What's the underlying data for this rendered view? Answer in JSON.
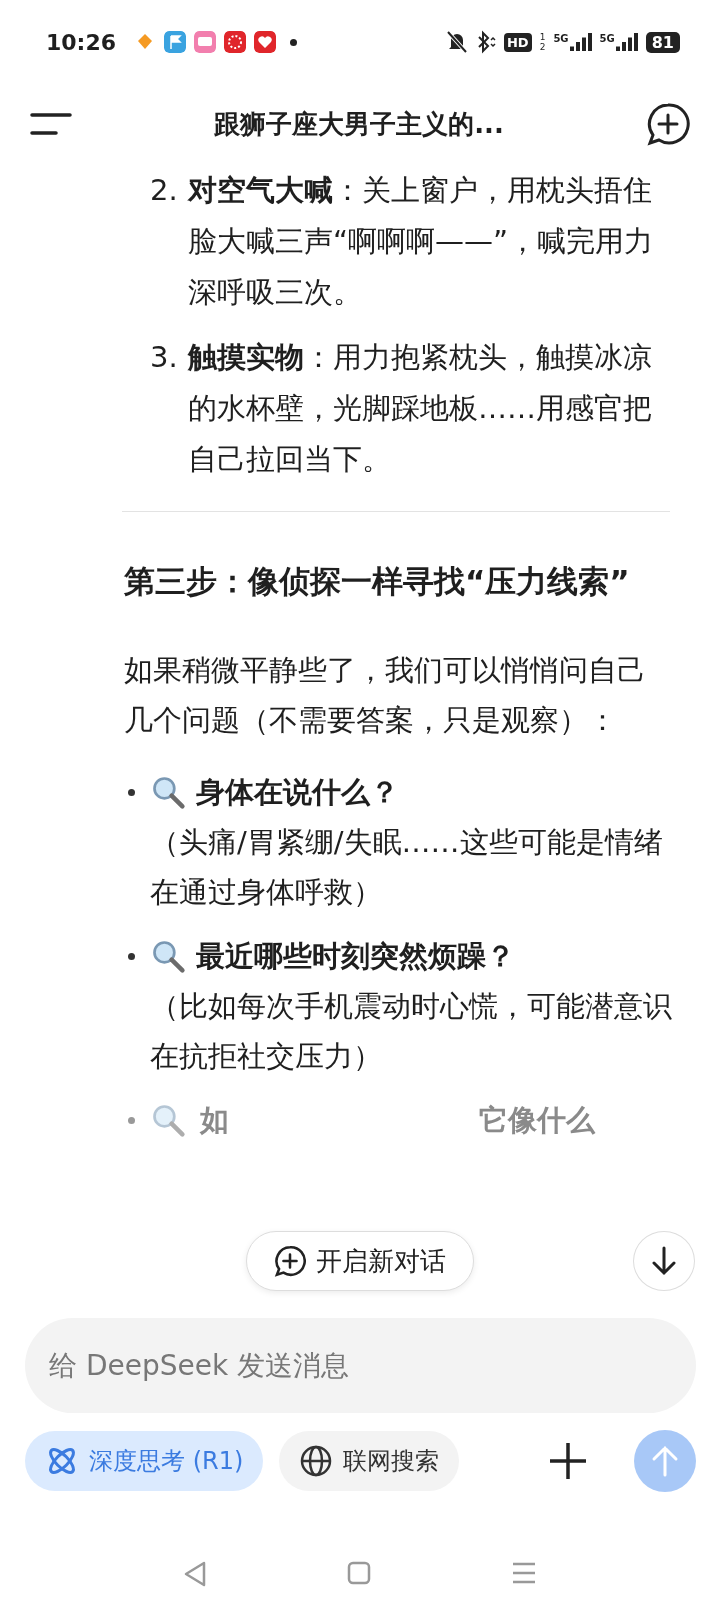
{
  "status_bar": {
    "time": "10:26",
    "hd": "HD",
    "sim_slots": [
      "1",
      "2"
    ],
    "networks": [
      "5G",
      "5G"
    ],
    "battery": "81"
  },
  "header": {
    "title": "跟狮子座大男子主义的..."
  },
  "steps": [
    {
      "number": "2.",
      "text": "**对空气大喊**：关上窗户，用枕头捂住脸大喊三声“啊啊啊——”，喊完用力深呼吸三次。"
    },
    {
      "number": "3.",
      "text": "**触摸实物**：用力抱紧枕头，触摸冰凉的水杯壁，光脚踩地板……用感官把自己拉回当下。"
    }
  ],
  "heading": "第三步：像侦探一样寻找“压力线索”",
  "paragraph": "如果稍微平静些了，我们可以悄悄问自己几个问题（不需要答案，只是观察）：",
  "bullets": [
    {
      "title": "身体在说什么？",
      "text": "（头痛/胃紧绷/失眠……这些可能是情绪在通过身体呼救）"
    },
    {
      "title": "最近哪些时刻突然烦躁？",
      "text": "（比如每次手机震动时心慌，可能潜意识在抗拒社交压力）"
    }
  ],
  "covered_bullet": {
    "before": "如",
    "after": "它像什么"
  },
  "new_chat_button": "开启新对话",
  "composer": {
    "placeholder": "给 DeepSeek 发送消息"
  },
  "toggles": [
    {
      "kind": "deep-think",
      "label": "深度思考 (R1)",
      "selected": true
    },
    {
      "kind": "web-search",
      "label": "联网搜索",
      "selected": false
    }
  ],
  "send_disabled": true
}
